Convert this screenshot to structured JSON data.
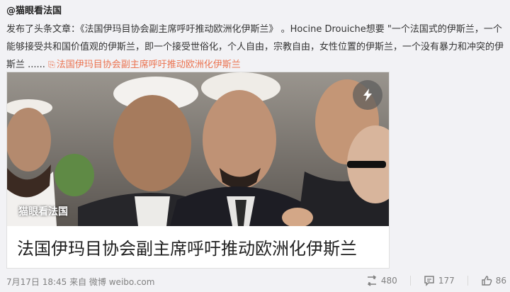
{
  "post": {
    "author": "@猫眼看法国",
    "lines": [
      "发布了头条文章：《法国伊玛目协会副主席呼吁推动欧洲化伊斯兰》 。Hocine Drouiche想要 \"一个法国式的伊斯兰，一个",
      "能够接受共和国价值观的伊斯兰，即一个接受世俗化，个人自由，宗教自由，女性位置的伊斯兰，一个没有暴力和冲突的伊",
      "斯兰 ......"
    ],
    "link_icon": "doc-icon",
    "link_text": "法国伊玛目协会副主席呼吁推动欧洲化伊斯兰"
  },
  "card": {
    "watermark": "猫眼看法国",
    "title": "法国伊玛目协会副主席呼吁推动欧洲化伊斯兰",
    "badge_icon": "lightning-icon"
  },
  "footer": {
    "meta": "7月17日 18:45 来自 微博 weibo.com",
    "repost_count": "480",
    "comment_count": "177",
    "like_count": "86"
  },
  "colors": {
    "link": "#eb7350",
    "background": "#f2f2f5"
  }
}
